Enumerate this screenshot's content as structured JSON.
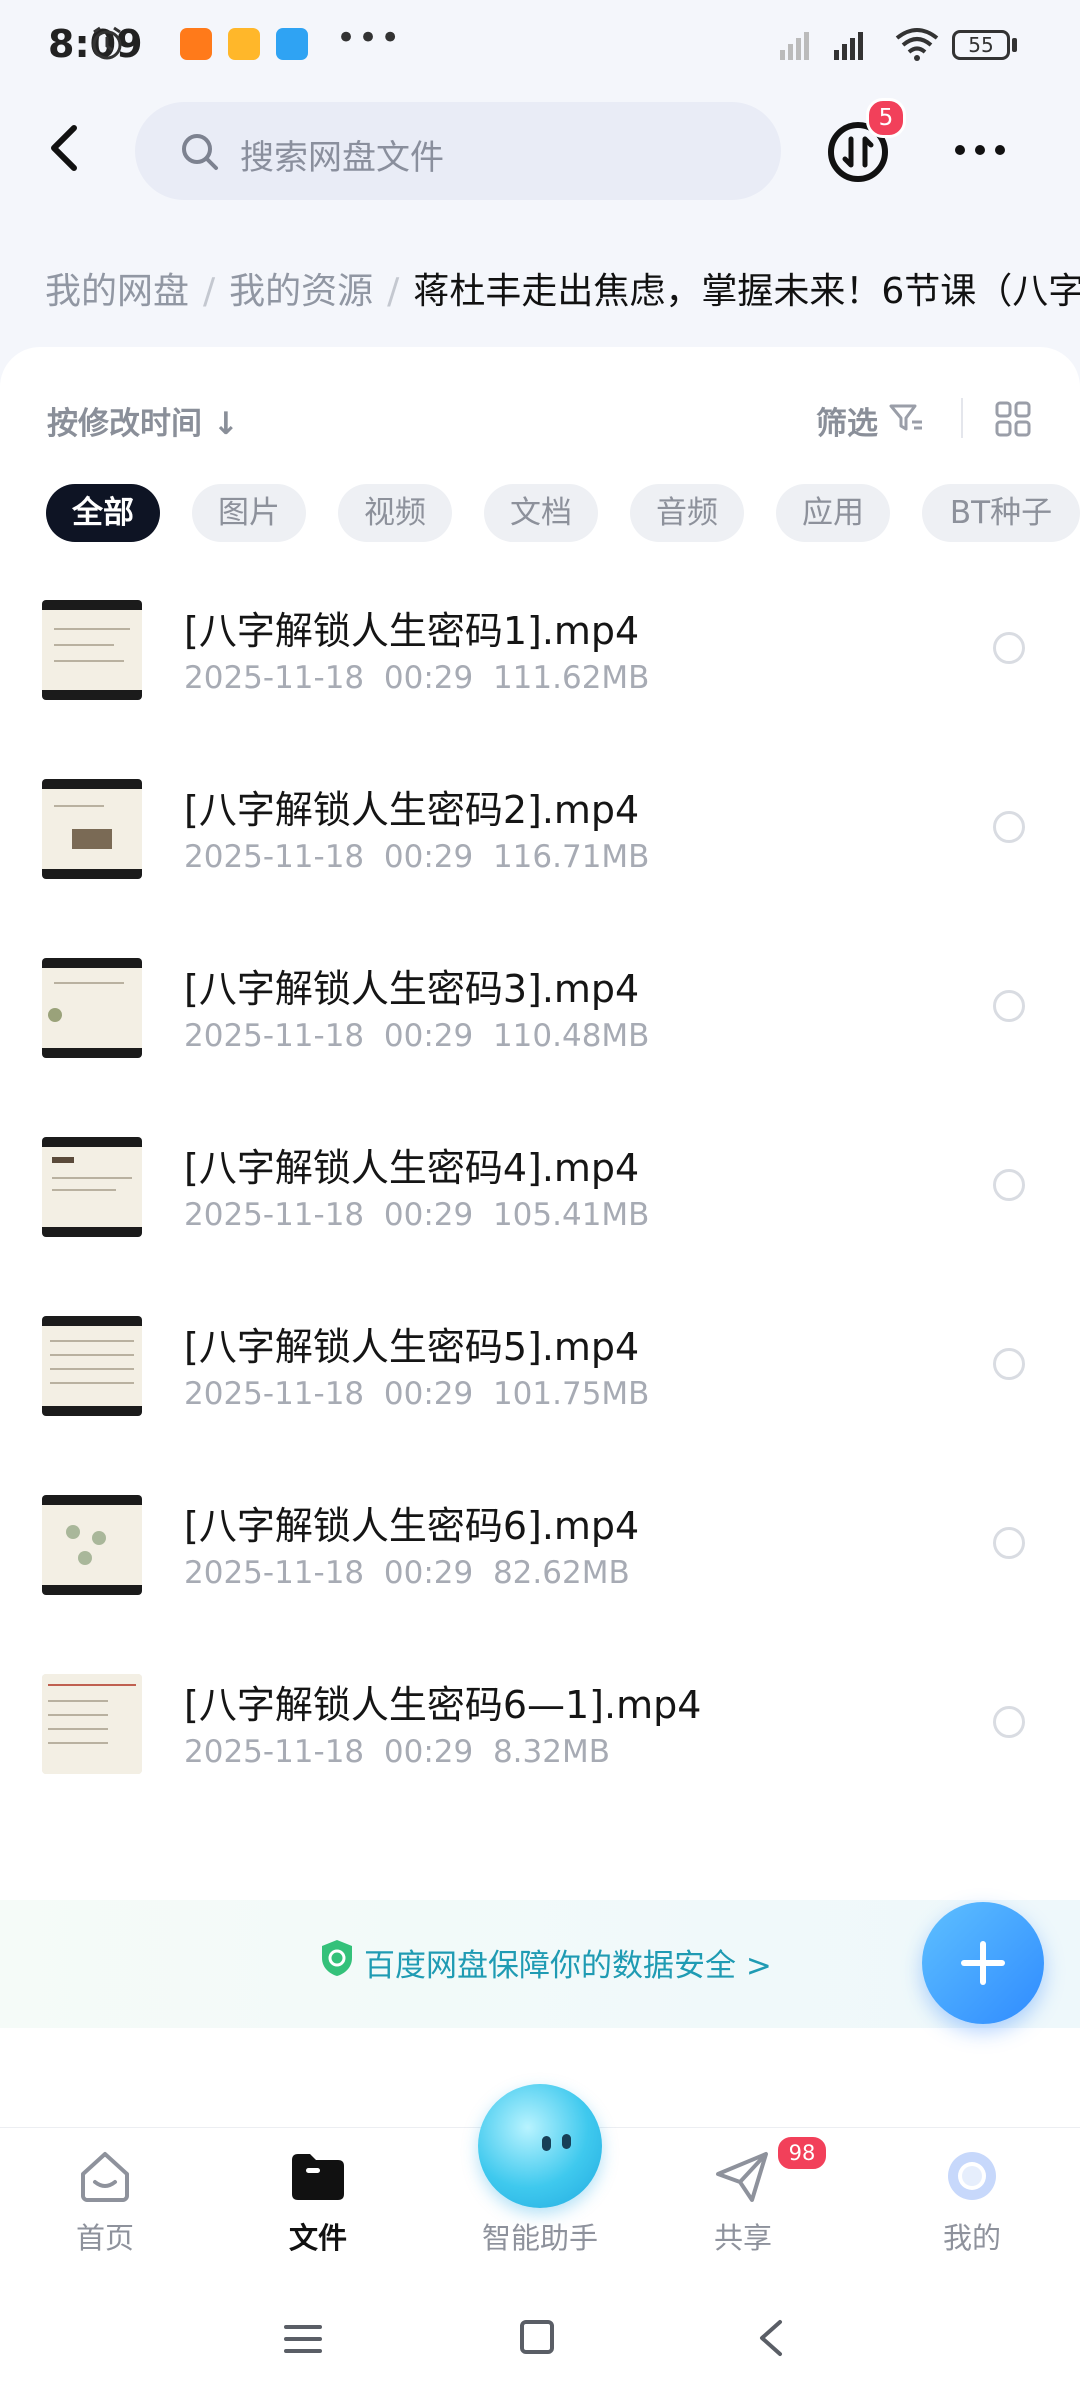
{
  "status_bar": {
    "time": "8:09",
    "battery": "55"
  },
  "header": {
    "search_placeholder": "搜索网盘文件",
    "transfer_badge": "5"
  },
  "breadcrumb": {
    "items": [
      "我的网盘",
      "我的资源"
    ],
    "current": "蒋杜丰走出焦虑，掌握未来！6节课（八字"
  },
  "toolbar": {
    "sort_label": "按修改时间 ↓",
    "filter_label": "筛选"
  },
  "filter_chips": [
    "全部",
    "图片",
    "视频",
    "文档",
    "音频",
    "应用",
    "BT种子"
  ],
  "files": [
    {
      "name": "[八字解锁人生密码1].mp4",
      "date": "2025-11-18",
      "time": "00:29",
      "size": "111.62MB"
    },
    {
      "name": "[八字解锁人生密码2].mp4",
      "date": "2025-11-18",
      "time": "00:29",
      "size": "116.71MB"
    },
    {
      "name": "[八字解锁人生密码3].mp4",
      "date": "2025-11-18",
      "time": "00:29",
      "size": "110.48MB"
    },
    {
      "name": "[八字解锁人生密码4].mp4",
      "date": "2025-11-18",
      "time": "00:29",
      "size": "105.41MB"
    },
    {
      "name": "[八字解锁人生密码5].mp4",
      "date": "2025-11-18",
      "time": "00:29",
      "size": "101.75MB"
    },
    {
      "name": "[八字解锁人生密码6].mp4",
      "date": "2025-11-18",
      "time": "00:29",
      "size": "82.62MB"
    },
    {
      "name": "[八字解锁人生密码6—1].mp4",
      "date": "2025-11-18",
      "time": "00:29",
      "size": "8.32MB"
    }
  ],
  "safety_banner": "百度网盘保障你的数据安全 >",
  "bottom_nav": {
    "items": [
      "首页",
      "文件",
      "智能助手",
      "共享",
      "我的"
    ],
    "share_badge": "98"
  },
  "colors": {
    "accent": "#2f8bff",
    "badge": "#f2405a",
    "active_chip": "#0e1424"
  }
}
